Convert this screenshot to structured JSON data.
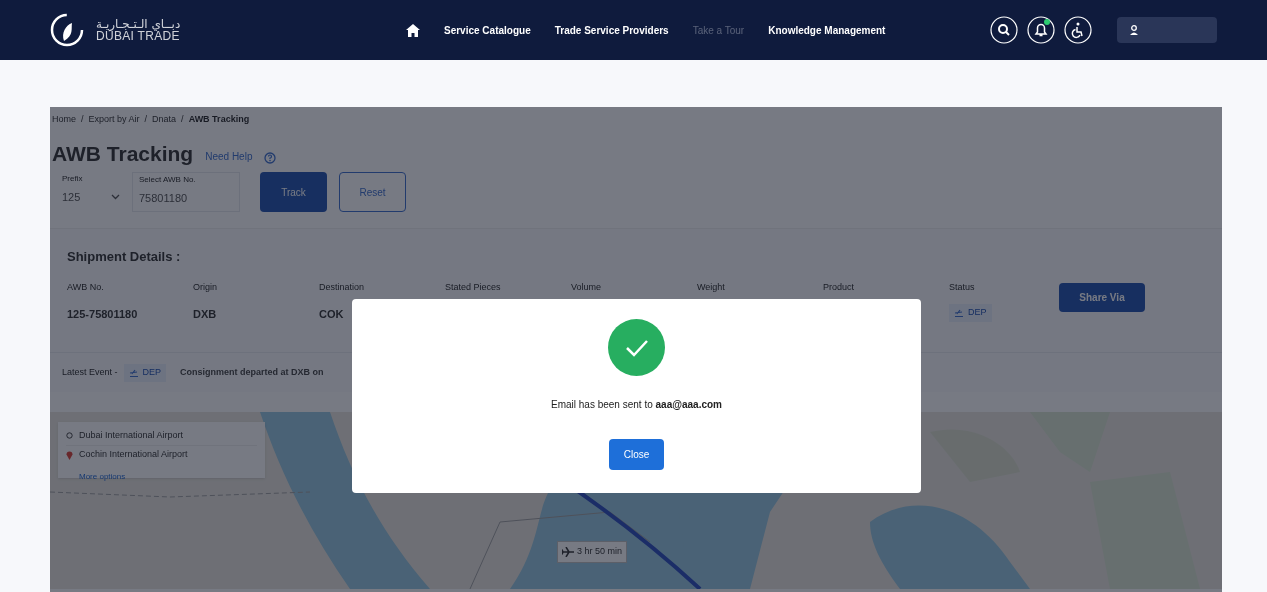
{
  "header": {
    "logo_arabic": "دبــاي الـتـجـاريـة",
    "logo_text": "DUBAI TRADE",
    "nav": [
      {
        "label": "Service Catalogue",
        "disabled": false
      },
      {
        "label": "Trade Service Providers",
        "disabled": false
      },
      {
        "label": "Take a Tour",
        "disabled": true
      },
      {
        "label": "Knowledge Management",
        "disabled": false
      }
    ],
    "notification_dot": true
  },
  "breadcrumb_separator": "/",
  "breadcrumb": [
    {
      "label": "Home",
      "current": false
    },
    {
      "label": "Export by Air",
      "current": false
    },
    {
      "label": "Dnata",
      "current": false
    },
    {
      "label": "AWB Tracking",
      "current": true
    }
  ],
  "title": "AWB Tracking",
  "help_link": "Need Help",
  "form": {
    "prefix_label": "Prefix",
    "prefix_value": "125",
    "awb_label": "Select AWB No.",
    "awb_value": "75801180",
    "buttons": [
      {
        "label": "Track",
        "kind": "primary"
      },
      {
        "label": "Reset",
        "kind": "outline"
      }
    ]
  },
  "shipment": {
    "heading": "Shipment Details :",
    "columns": [
      "AWB No.",
      "Origin",
      "Destination",
      "Stated Pieces",
      "Volume",
      "Weight",
      "Product",
      "Status"
    ],
    "values": [
      "125-75801180",
      "DXB",
      "COK"
    ],
    "status": "DEP",
    "share_button": "Share Via"
  },
  "latest_event": {
    "label": "Latest Event -",
    "status": "DEP",
    "text": "Consignment departed at DXB on"
  },
  "map": {
    "origin": "Dubai International Airport",
    "destination": "Cochin International Airport",
    "more": "More options",
    "duration": "3 hr 50 min"
  },
  "modal": {
    "message": "Email has been sent to **aaa@aaa.com**",
    "button": "Close"
  }
}
